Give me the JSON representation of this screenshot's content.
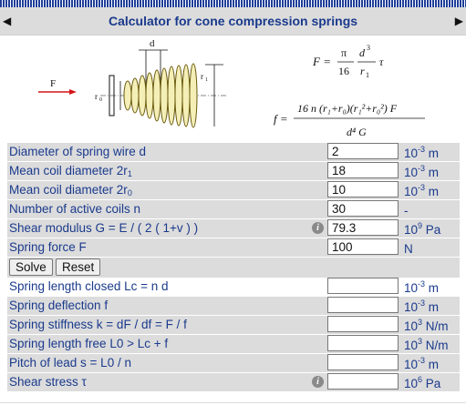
{
  "header": {
    "title": "Calculator for cone compression springs",
    "prev_icon": "triangle-left-icon",
    "next_icon": "triangle-right-icon"
  },
  "figure": {
    "label_d": "d",
    "label_F": "F",
    "label_r1": "r",
    "label_r1_sub": "1",
    "label_r0": "r",
    "label_r0_sub": "0"
  },
  "formulas": {
    "force_lhs": "F =",
    "force_pi": "π",
    "force_16": "16",
    "force_d3": "d",
    "force_d3_exp": "3",
    "force_r1": "r",
    "force_r1_sub": "1",
    "force_tau": "τ",
    "defl_lhs": "f =",
    "defl_num": "16 n (r₁+r₀)(r₁²+r₀²) F",
    "defl_den": "d⁴ G"
  },
  "inputs": [
    {
      "label": "Diameter of spring wire d",
      "value": "2",
      "unit": "10",
      "unit_exp": "-3",
      "unit_suffix": " m"
    },
    {
      "label": "Mean coil diameter 2r",
      "label_sub": "1",
      "value": "18",
      "unit": "10",
      "unit_exp": "-3",
      "unit_suffix": " m"
    },
    {
      "label": "Mean coil diameter 2r",
      "label_sub": "0",
      "value": "10",
      "unit": "10",
      "unit_exp": "-3",
      "unit_suffix": " m"
    },
    {
      "label": "Number of active coils n",
      "value": "30",
      "unit": "-",
      "unit_exp": "",
      "unit_suffix": ""
    },
    {
      "label": "Shear modulus G = E / ( 2 ( 1+v ) )",
      "value": "79.3",
      "unit": "10",
      "unit_exp": "9",
      "unit_suffix": " Pa"
    },
    {
      "label": "Spring force F",
      "value": "100",
      "unit": "N",
      "unit_exp": "",
      "unit_suffix": ""
    }
  ],
  "buttons": {
    "solve": "Solve",
    "reset": "Reset"
  },
  "outputs": [
    {
      "label": "Spring length closed Lc = n d",
      "value": "",
      "unit": "10",
      "unit_exp": "-3",
      "unit_suffix": " m"
    },
    {
      "label": "Spring deflection f",
      "value": "",
      "unit": "10",
      "unit_exp": "-3",
      "unit_suffix": " m"
    },
    {
      "label": "Spring stiffness k = dF / df = F / f",
      "value": "",
      "unit": "10",
      "unit_exp": "3",
      "unit_suffix": " N/m"
    },
    {
      "label": "Spring length free L0 > Lc + f",
      "value": "",
      "unit": "10",
      "unit_exp": "3",
      "unit_suffix": " N/m"
    },
    {
      "label": "Pitch of lead s = L0 / n",
      "value": "",
      "unit": "10",
      "unit_exp": "-3",
      "unit_suffix": " m"
    },
    {
      "label": "Shear stress τ",
      "value": "",
      "unit": "10",
      "unit_exp": "6",
      "unit_suffix": " Pa"
    }
  ],
  "info_icon": "info-icon"
}
